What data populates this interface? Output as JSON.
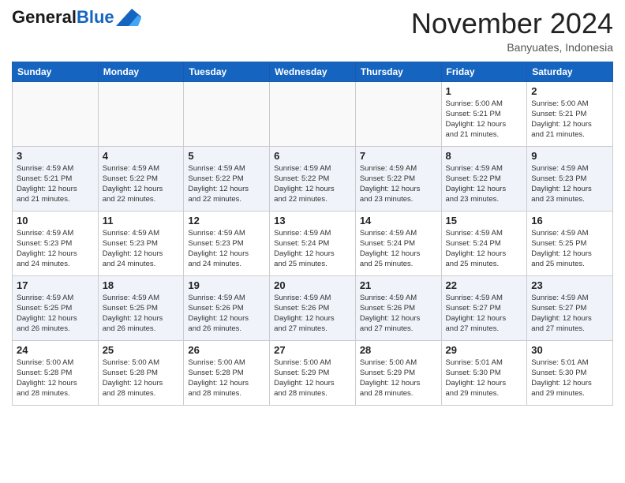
{
  "header": {
    "logo_line1": "General",
    "logo_line2": "Blue",
    "month": "November 2024",
    "location": "Banyuates, Indonesia"
  },
  "weekdays": [
    "Sunday",
    "Monday",
    "Tuesday",
    "Wednesday",
    "Thursday",
    "Friday",
    "Saturday"
  ],
  "weeks": [
    [
      {
        "day": "",
        "info": ""
      },
      {
        "day": "",
        "info": ""
      },
      {
        "day": "",
        "info": ""
      },
      {
        "day": "",
        "info": ""
      },
      {
        "day": "",
        "info": ""
      },
      {
        "day": "1",
        "info": "Sunrise: 5:00 AM\nSunset: 5:21 PM\nDaylight: 12 hours\nand 21 minutes."
      },
      {
        "day": "2",
        "info": "Sunrise: 5:00 AM\nSunset: 5:21 PM\nDaylight: 12 hours\nand 21 minutes."
      }
    ],
    [
      {
        "day": "3",
        "info": "Sunrise: 4:59 AM\nSunset: 5:21 PM\nDaylight: 12 hours\nand 21 minutes."
      },
      {
        "day": "4",
        "info": "Sunrise: 4:59 AM\nSunset: 5:22 PM\nDaylight: 12 hours\nand 22 minutes."
      },
      {
        "day": "5",
        "info": "Sunrise: 4:59 AM\nSunset: 5:22 PM\nDaylight: 12 hours\nand 22 minutes."
      },
      {
        "day": "6",
        "info": "Sunrise: 4:59 AM\nSunset: 5:22 PM\nDaylight: 12 hours\nand 22 minutes."
      },
      {
        "day": "7",
        "info": "Sunrise: 4:59 AM\nSunset: 5:22 PM\nDaylight: 12 hours\nand 23 minutes."
      },
      {
        "day": "8",
        "info": "Sunrise: 4:59 AM\nSunset: 5:22 PM\nDaylight: 12 hours\nand 23 minutes."
      },
      {
        "day": "9",
        "info": "Sunrise: 4:59 AM\nSunset: 5:23 PM\nDaylight: 12 hours\nand 23 minutes."
      }
    ],
    [
      {
        "day": "10",
        "info": "Sunrise: 4:59 AM\nSunset: 5:23 PM\nDaylight: 12 hours\nand 24 minutes."
      },
      {
        "day": "11",
        "info": "Sunrise: 4:59 AM\nSunset: 5:23 PM\nDaylight: 12 hours\nand 24 minutes."
      },
      {
        "day": "12",
        "info": "Sunrise: 4:59 AM\nSunset: 5:23 PM\nDaylight: 12 hours\nand 24 minutes."
      },
      {
        "day": "13",
        "info": "Sunrise: 4:59 AM\nSunset: 5:24 PM\nDaylight: 12 hours\nand 25 minutes."
      },
      {
        "day": "14",
        "info": "Sunrise: 4:59 AM\nSunset: 5:24 PM\nDaylight: 12 hours\nand 25 minutes."
      },
      {
        "day": "15",
        "info": "Sunrise: 4:59 AM\nSunset: 5:24 PM\nDaylight: 12 hours\nand 25 minutes."
      },
      {
        "day": "16",
        "info": "Sunrise: 4:59 AM\nSunset: 5:25 PM\nDaylight: 12 hours\nand 25 minutes."
      }
    ],
    [
      {
        "day": "17",
        "info": "Sunrise: 4:59 AM\nSunset: 5:25 PM\nDaylight: 12 hours\nand 26 minutes."
      },
      {
        "day": "18",
        "info": "Sunrise: 4:59 AM\nSunset: 5:25 PM\nDaylight: 12 hours\nand 26 minutes."
      },
      {
        "day": "19",
        "info": "Sunrise: 4:59 AM\nSunset: 5:26 PM\nDaylight: 12 hours\nand 26 minutes."
      },
      {
        "day": "20",
        "info": "Sunrise: 4:59 AM\nSunset: 5:26 PM\nDaylight: 12 hours\nand 27 minutes."
      },
      {
        "day": "21",
        "info": "Sunrise: 4:59 AM\nSunset: 5:26 PM\nDaylight: 12 hours\nand 27 minutes."
      },
      {
        "day": "22",
        "info": "Sunrise: 4:59 AM\nSunset: 5:27 PM\nDaylight: 12 hours\nand 27 minutes."
      },
      {
        "day": "23",
        "info": "Sunrise: 4:59 AM\nSunset: 5:27 PM\nDaylight: 12 hours\nand 27 minutes."
      }
    ],
    [
      {
        "day": "24",
        "info": "Sunrise: 5:00 AM\nSunset: 5:28 PM\nDaylight: 12 hours\nand 28 minutes."
      },
      {
        "day": "25",
        "info": "Sunrise: 5:00 AM\nSunset: 5:28 PM\nDaylight: 12 hours\nand 28 minutes."
      },
      {
        "day": "26",
        "info": "Sunrise: 5:00 AM\nSunset: 5:28 PM\nDaylight: 12 hours\nand 28 minutes."
      },
      {
        "day": "27",
        "info": "Sunrise: 5:00 AM\nSunset: 5:29 PM\nDaylight: 12 hours\nand 28 minutes."
      },
      {
        "day": "28",
        "info": "Sunrise: 5:00 AM\nSunset: 5:29 PM\nDaylight: 12 hours\nand 28 minutes."
      },
      {
        "day": "29",
        "info": "Sunrise: 5:01 AM\nSunset: 5:30 PM\nDaylight: 12 hours\nand 29 minutes."
      },
      {
        "day": "30",
        "info": "Sunrise: 5:01 AM\nSunset: 5:30 PM\nDaylight: 12 hours\nand 29 minutes."
      }
    ]
  ]
}
